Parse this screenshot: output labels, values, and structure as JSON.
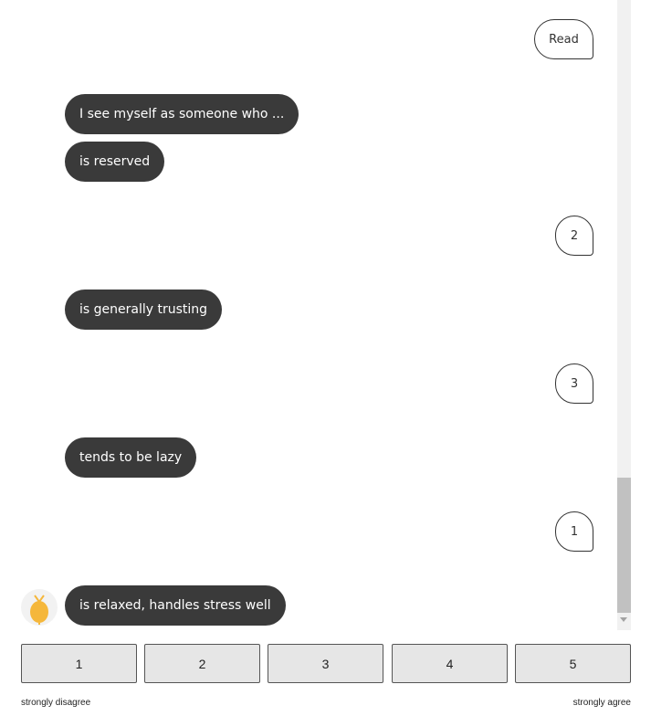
{
  "messages": [
    {
      "from": "user",
      "text": "Read"
    },
    {
      "from": "bot",
      "text": "I see myself as someone who ..."
    },
    {
      "from": "bot",
      "text": "is reserved"
    },
    {
      "from": "user",
      "text": "2"
    },
    {
      "from": "bot",
      "text": "is generally trusting"
    },
    {
      "from": "user",
      "text": "3"
    },
    {
      "from": "bot",
      "text": "tends to be lazy"
    },
    {
      "from": "user",
      "text": "1"
    },
    {
      "from": "bot",
      "text": "is relaxed, handles stress well"
    }
  ],
  "avatar": {
    "icon": "lemon-icon",
    "color": "#f5b73b"
  },
  "scale": {
    "options": [
      "1",
      "2",
      "3",
      "4",
      "5"
    ],
    "min_label": "strongly disagree",
    "max_label": "strongly agree"
  },
  "colors": {
    "bot_bubble": "#3a3a3a",
    "button_bg": "#e6e6e6"
  }
}
